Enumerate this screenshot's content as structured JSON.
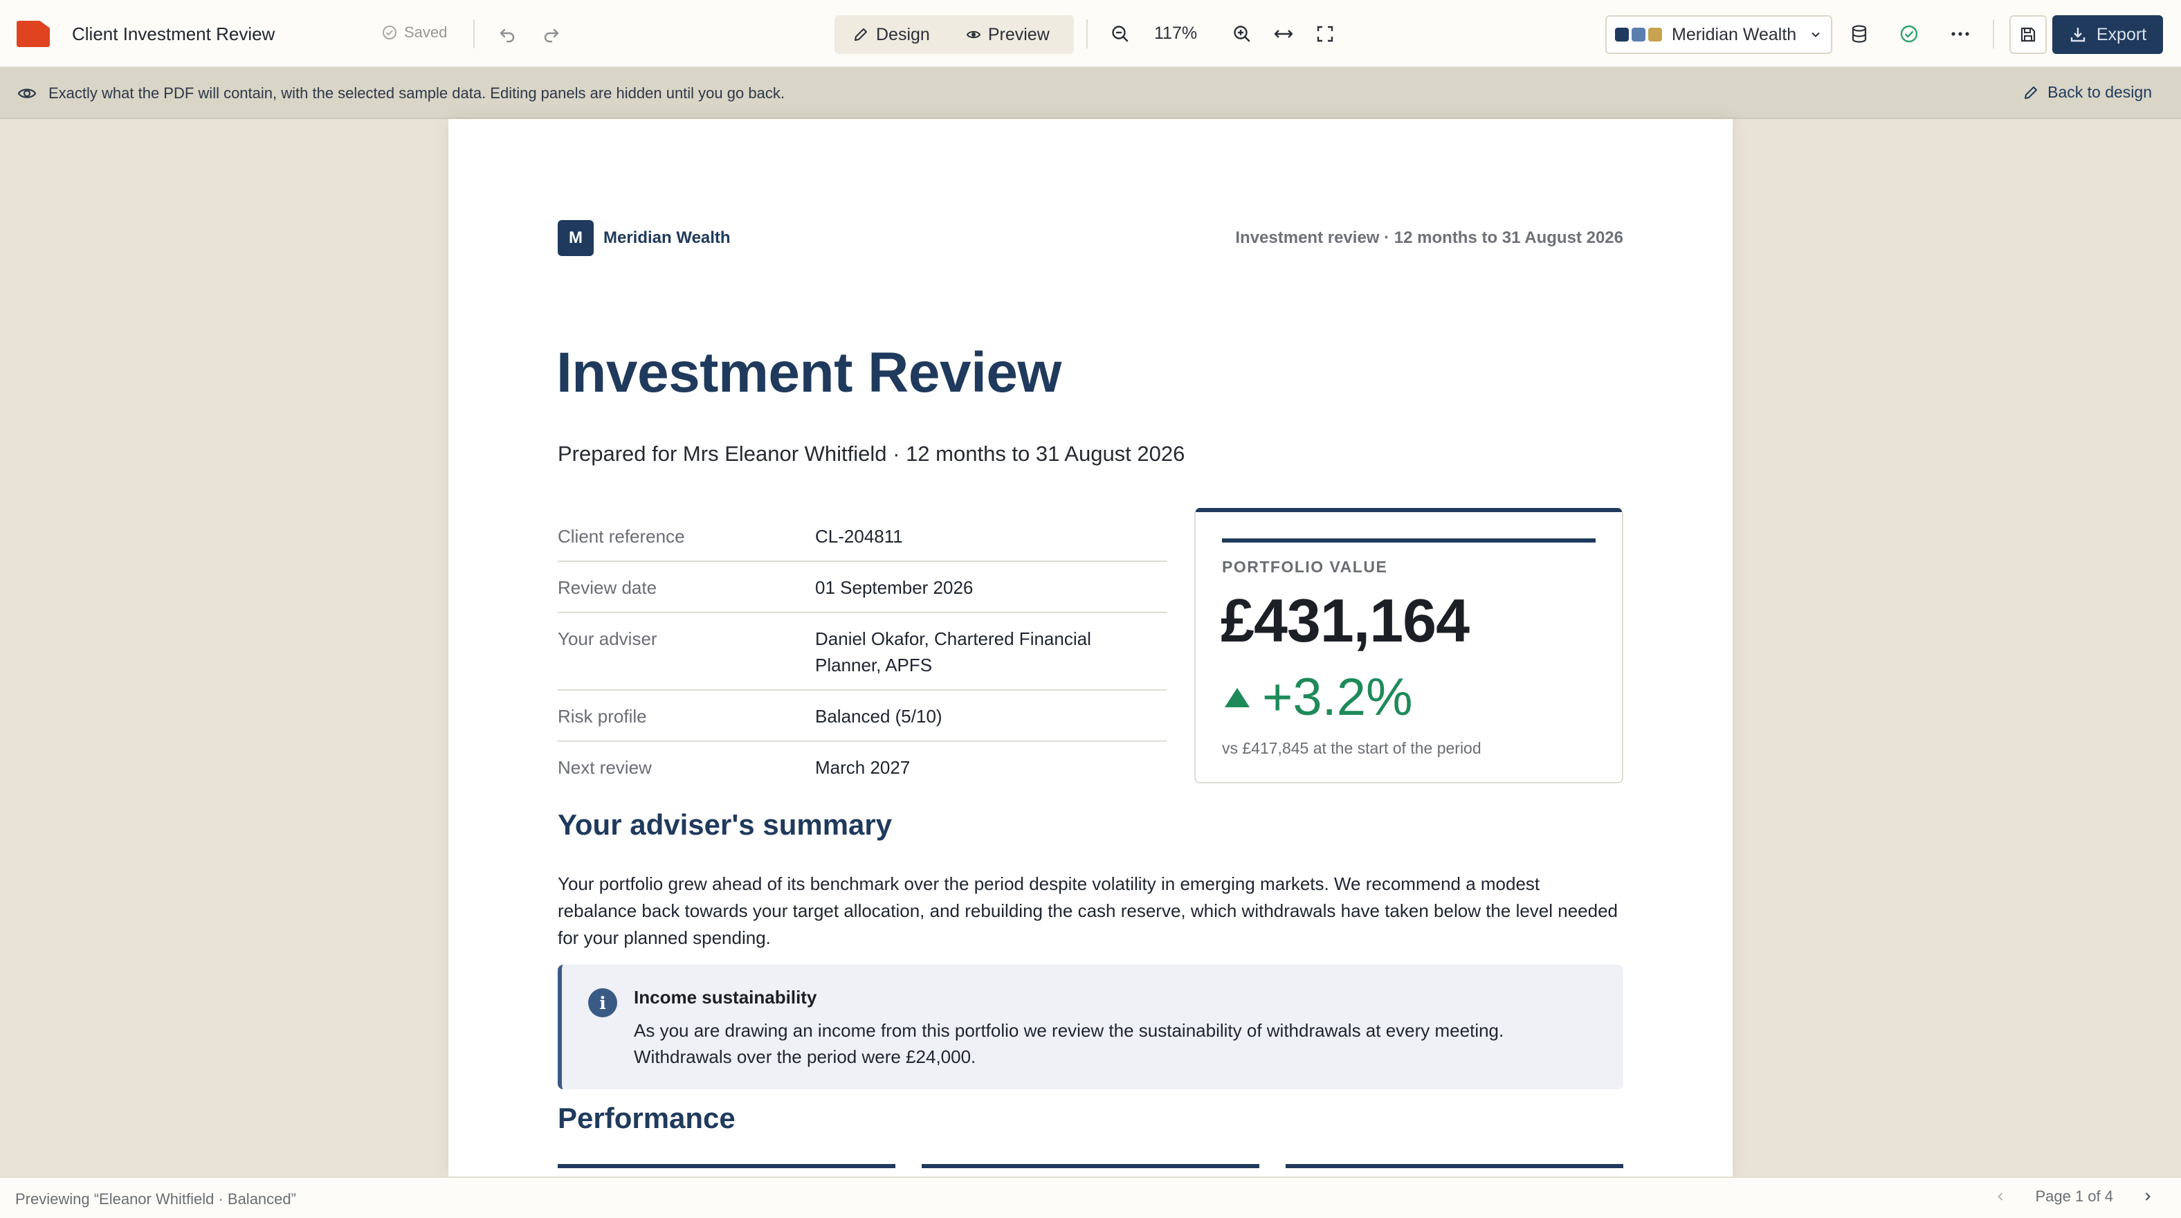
{
  "app": {
    "doc_title": "Client Investment Review",
    "saved_label": "Saved",
    "icons": {
      "undo": "undo-icon",
      "redo": "redo-icon"
    }
  },
  "modes": [
    {
      "label": "Design",
      "icon": "pencil-icon",
      "active": false
    },
    {
      "label": "Preview",
      "icon": "eye-icon",
      "active": true
    }
  ],
  "zoom": {
    "level": "117%"
  },
  "brand_select": {
    "label": "Meridian Wealth",
    "swatches": [
      "#1f3a5c",
      "#5a7fae",
      "#c8a24e"
    ]
  },
  "toolbar": {
    "export_label": "Export"
  },
  "banner": {
    "text": "Exactly what the PDF will contain, with the selected sample data. Editing panels are hidden until you go back.",
    "back_label": "Back to design"
  },
  "document": {
    "brand_initial": "M",
    "brand_name": "Meridian Wealth",
    "header_right": "Investment review · 12 months to 31 August 2026",
    "title": "Investment Review",
    "subtitle": "Prepared for Mrs Eleanor Whitfield · 12 months to 31 August 2026",
    "facts": [
      {
        "label": "Client reference",
        "value": "CL-204811"
      },
      {
        "label": "Review date",
        "value": "01 September 2026"
      },
      {
        "label": "Your adviser",
        "value": "Daniel Okafor, Chartered Financial Planner, APFS"
      },
      {
        "label": "Risk profile",
        "value": "Balanced (5/10)"
      },
      {
        "label": "Next review",
        "value": "March 2027"
      }
    ],
    "portfolio": {
      "label": "PORTFOLIO VALUE",
      "value": "£431,164",
      "change": "+3.2%",
      "note": "vs £417,845 at the start of the period"
    },
    "summary_heading": "Your adviser's summary",
    "summary_text": "Your portfolio grew ahead of its benchmark over the period despite volatility in emerging markets. We recommend a modest rebalance back towards your target allocation, and rebuilding the cash reserve, which withdrawals have taken below the level needed for your planned spending.",
    "callout": {
      "title": "Income sustainability",
      "body": "As you are drawing an income from this portfolio we review the sustainability of withdrawals at every meeting. Withdrawals over the period were £24,000."
    },
    "performance_heading": "Performance"
  },
  "footer": {
    "preview_text": "Previewing “Eleanor Whitfield · Balanced”",
    "page_label": "Page 1 of 4"
  },
  "colors": {
    "primary": "#1f3a5c",
    "positive": "#1e8a5a",
    "accent": "#e0431f",
    "success": "#2ea36c"
  }
}
